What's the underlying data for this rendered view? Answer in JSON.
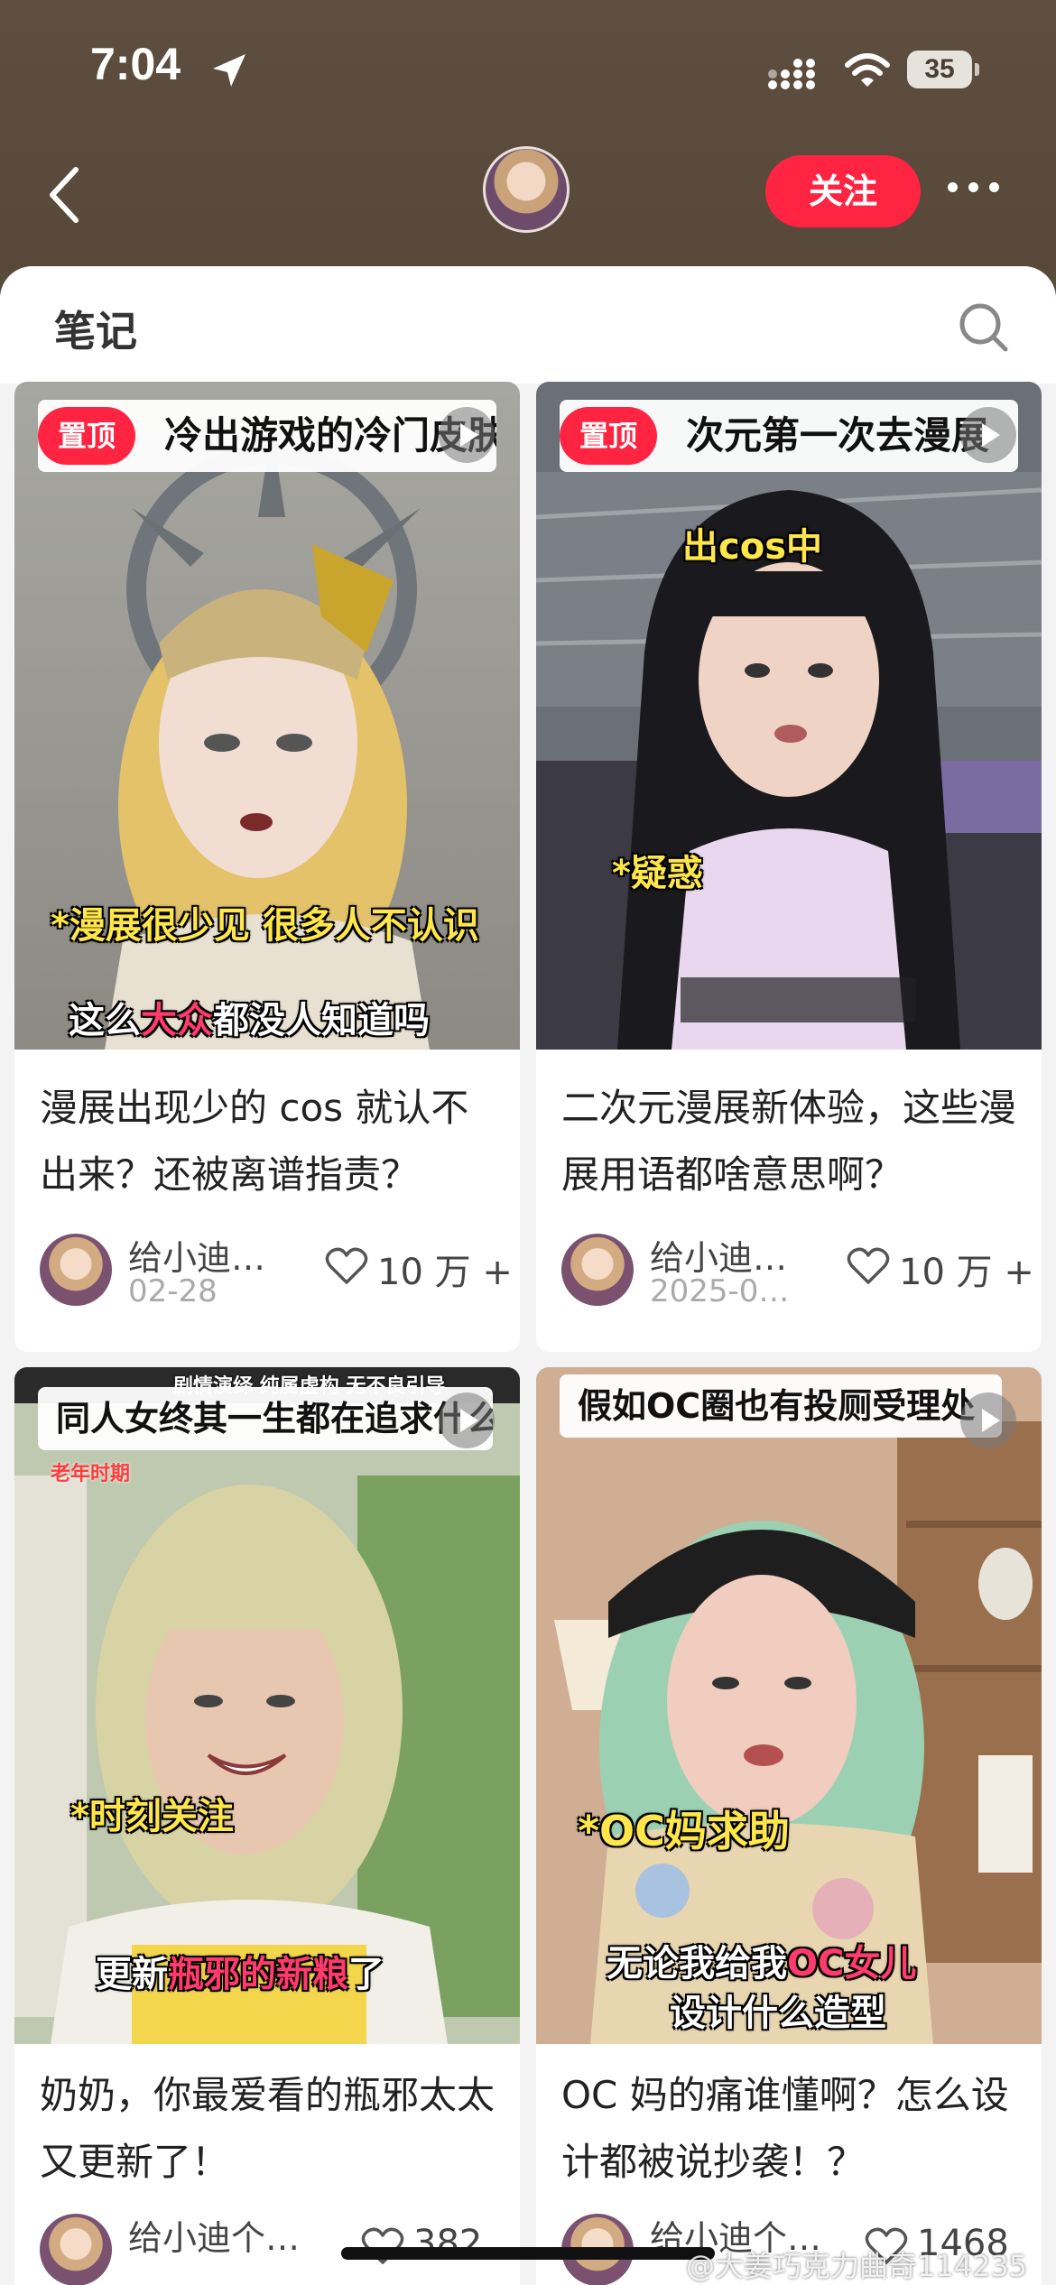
{
  "status_bar": {
    "time": "7:04",
    "battery": "35"
  },
  "nav": {
    "follow_label": "关注"
  },
  "section": {
    "title": "笔记"
  },
  "pin_label": "置顶",
  "cards": [
    {
      "cover_title": "冷出游戏的冷门皮肤",
      "overlay_yellow": "*漫展很少见 很多人不认识",
      "overlay_white_pre": "这么",
      "overlay_white_hl": "大众",
      "overlay_white_post": "都没人知道吗",
      "title": "漫展出现少的 cos 就认不出来？还被离谱指责？",
      "author": "给小迪…",
      "date": "02-28",
      "likes": "10 万 +"
    },
    {
      "cover_title": "次元第一次去漫展",
      "overlay_yellow_1": "出cos中",
      "overlay_yellow_2": "*疑惑",
      "title": "二次元漫展新体验，这些漫展用语都啥意思啊？",
      "author": "给小迪…",
      "date": "2025-0…",
      "likes": "10 万 +"
    },
    {
      "cover_title": "同人女终其一生都在追求什么",
      "overlay_small_top": "剧情演绎 纯属虚构 无不良引导",
      "overlay_tag": "老年时期",
      "overlay_yellow": "*时刻关注",
      "overlay_white_pre": "更新",
      "overlay_white_hl": "瓶邪的新粮",
      "overlay_white_post": "了",
      "title": "奶奶，你最爱看的瓶邪太太又更新了！",
      "author": "给小迪个…",
      "likes": "382"
    },
    {
      "cover_title": "假如OC圈也有投厕受理处",
      "overlay_yellow": "*OC妈求助",
      "overlay_white_pre": "无论我给我",
      "overlay_white_hl": "OC女儿",
      "overlay_white_line2": "设计什么造型",
      "title": "OC 妈的痛谁懂啊？怎么设计都被说抄袭！？",
      "author": "给小迪个…",
      "likes": "1468"
    }
  ],
  "watermark": "@大姜巧克力曲奇114235"
}
